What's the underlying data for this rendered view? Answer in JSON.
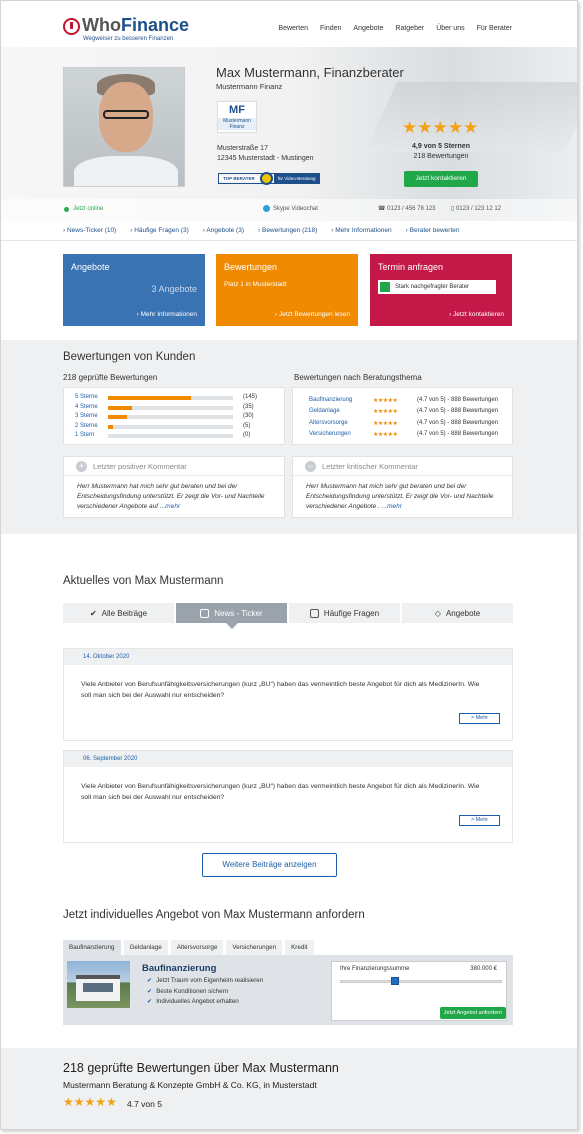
{
  "header": {
    "logo_who": "Who",
    "logo_finance": "Finance",
    "logo_tagline": "Wegweiser zu besseren Finanzen",
    "nav": [
      "Bewerten",
      "Finden",
      "Angebote",
      "Ratgeber",
      "Über uns",
      "Für Berater"
    ]
  },
  "profile": {
    "name": "Max Mustermann, Finanzberater",
    "company": "Mustermann Finanz",
    "logo_initials": "MF",
    "logo_sub": "Mustermann Finanz",
    "street": "Musterstraße 17",
    "city": "12345 Musterstadt - Mustingen",
    "badge_left": "TOP BERATER",
    "badge_right": "für Video-Beratung",
    "stars": "★★★★★",
    "rating": "4,9 von 5 Sternen",
    "count": "218 Bewertungen",
    "contact_button": "Jetzt kontaktieren",
    "online": "Jetzt online",
    "skype": "Skype Videochat",
    "phone": "0123 / 456 78 123",
    "mobile": "0123 / 123 12 12"
  },
  "subnav": [
    "News-Ticker (10)",
    "Häufige Fragen (3)",
    "Angebote (3)",
    "Bewertungen (218)",
    "Mehr Informationen",
    "Berater bewerten"
  ],
  "boxes": {
    "angebote": {
      "title": "Angebote",
      "sub": "3 Angebote",
      "link": "Mehr Informationen"
    },
    "bewertungen": {
      "title": "Bewertungen",
      "sub": "Platz 1 in Musterstadt",
      "link": "Jetzt Bewertungen lesen"
    },
    "termin": {
      "title": "Termin anfragen",
      "chip": "Stark nachgefragter Berater",
      "link": "Jetzt kontaktieren"
    }
  },
  "reviews": {
    "title": "Bewertungen von Kunden",
    "left_title": "218 geprüfte Bewertungen",
    "right_title": "Bewertungen nach Beratungsthema",
    "bars": [
      {
        "label": "5 Sterne",
        "count": "(145)",
        "fraction": 0.66
      },
      {
        "label": "4 Sterne",
        "count": "(35)",
        "fraction": 0.19
      },
      {
        "label": "3 Sterne",
        "count": "(30)",
        "fraction": 0.15
      },
      {
        "label": "2 Sterne",
        "count": "(5)",
        "fraction": 0.04
      },
      {
        "label": "1 Stern",
        "count": "(0)",
        "fraction": 0.0
      }
    ],
    "themes": [
      {
        "name": "Baufinanzierung",
        "stars": "★★★★★",
        "value": "(4.7 von 5) - 888 Bewertungen"
      },
      {
        "name": "Geldanlage",
        "stars": "★★★★★",
        "value": "(4.7 von 5) - 888 Bewertungen"
      },
      {
        "name": "Altersvorsorge",
        "stars": "★★★★★",
        "value": "(4.7 von 5) - 888 Bewertungen"
      },
      {
        "name": "Versicherungen",
        "stars": "★★★★★",
        "value": "(4.7 von 5) - 888 Bewertungen"
      }
    ],
    "positive_title": "Letzter positiver Kommentar",
    "positive_text": "Herr Mustermann hat mich sehr gut beraten und bei der Entscheidungsfindung unterstützt. Er zeigt die Vor- und Nachteile verschiedener Angebote auf",
    "negative_title": "Letzter kritischer Kommentar",
    "negative_text": "Herr Mustermann hat mich sehr gut beraten und bei der Entscheidungsfindung unterstützt. Er zeigt die Vor- und Nachteile verschiedener Angebote .",
    "more": "...mehr"
  },
  "news": {
    "title": "Aktuelles von Max Mustermann",
    "tabs": [
      "Alle Beiträge",
      "News - Ticker",
      "Häufige Fragen",
      "Angebote"
    ],
    "items": [
      {
        "date": "14. Oktober 2020",
        "text": "Viele Anbieter von Berufsunfähigkeitsversicherungen (kurz „BU“) haben das vermeintlich beste Angebot für dich als MedizinerIn. Wie soll man sich bei der Auswahl nur entscheiden?",
        "more": "> Mehr"
      },
      {
        "date": "06. September 2020",
        "text": "Viele Anbieter von Berufsunfähigkeitsversicherungen (kurz „BU“) haben das vermeintlich beste Angebot für dich als MedizinerIn. Wie soll man sich bei der Auswahl nur entscheiden?",
        "more": "> Mehr"
      }
    ],
    "more_button": "Weitere Beiträge anzeigen"
  },
  "offer": {
    "title": "Jetzt individuelles Angebot von Max Mustermann anfordern",
    "tabs": [
      "Baufinanzierung",
      "Geldanlage",
      "Altersvorsorge",
      "Versicherungen",
      "Kredit"
    ],
    "panel_title": "Baufinanzierung",
    "checks": [
      "Jetzt Traum vom Eigenheim realisieren",
      "Beste Konditionen sichern",
      "Individuelles Angebot erhalten"
    ],
    "calc_label": "Ihre Finanzierungssumme",
    "calc_value": "380.000 €",
    "button": "Jetzt Angebot anfordern"
  },
  "summary": {
    "title": "218 geprüfte Bewertungen über Max Mustermann",
    "subtitle": "Mustermann Beratung & Konzepte GmbH & Co. KG, in Musterstadt",
    "stars": "★★★★★",
    "rating": "4.7 von 5"
  },
  "colors": {
    "brand_blue": "#1d4f8a",
    "link_blue": "#1d5fa8",
    "green": "#1fa749",
    "orange": "#f08a00",
    "red": "#c41849",
    "box_blue": "#3a73b4",
    "star": "#f0a317"
  }
}
